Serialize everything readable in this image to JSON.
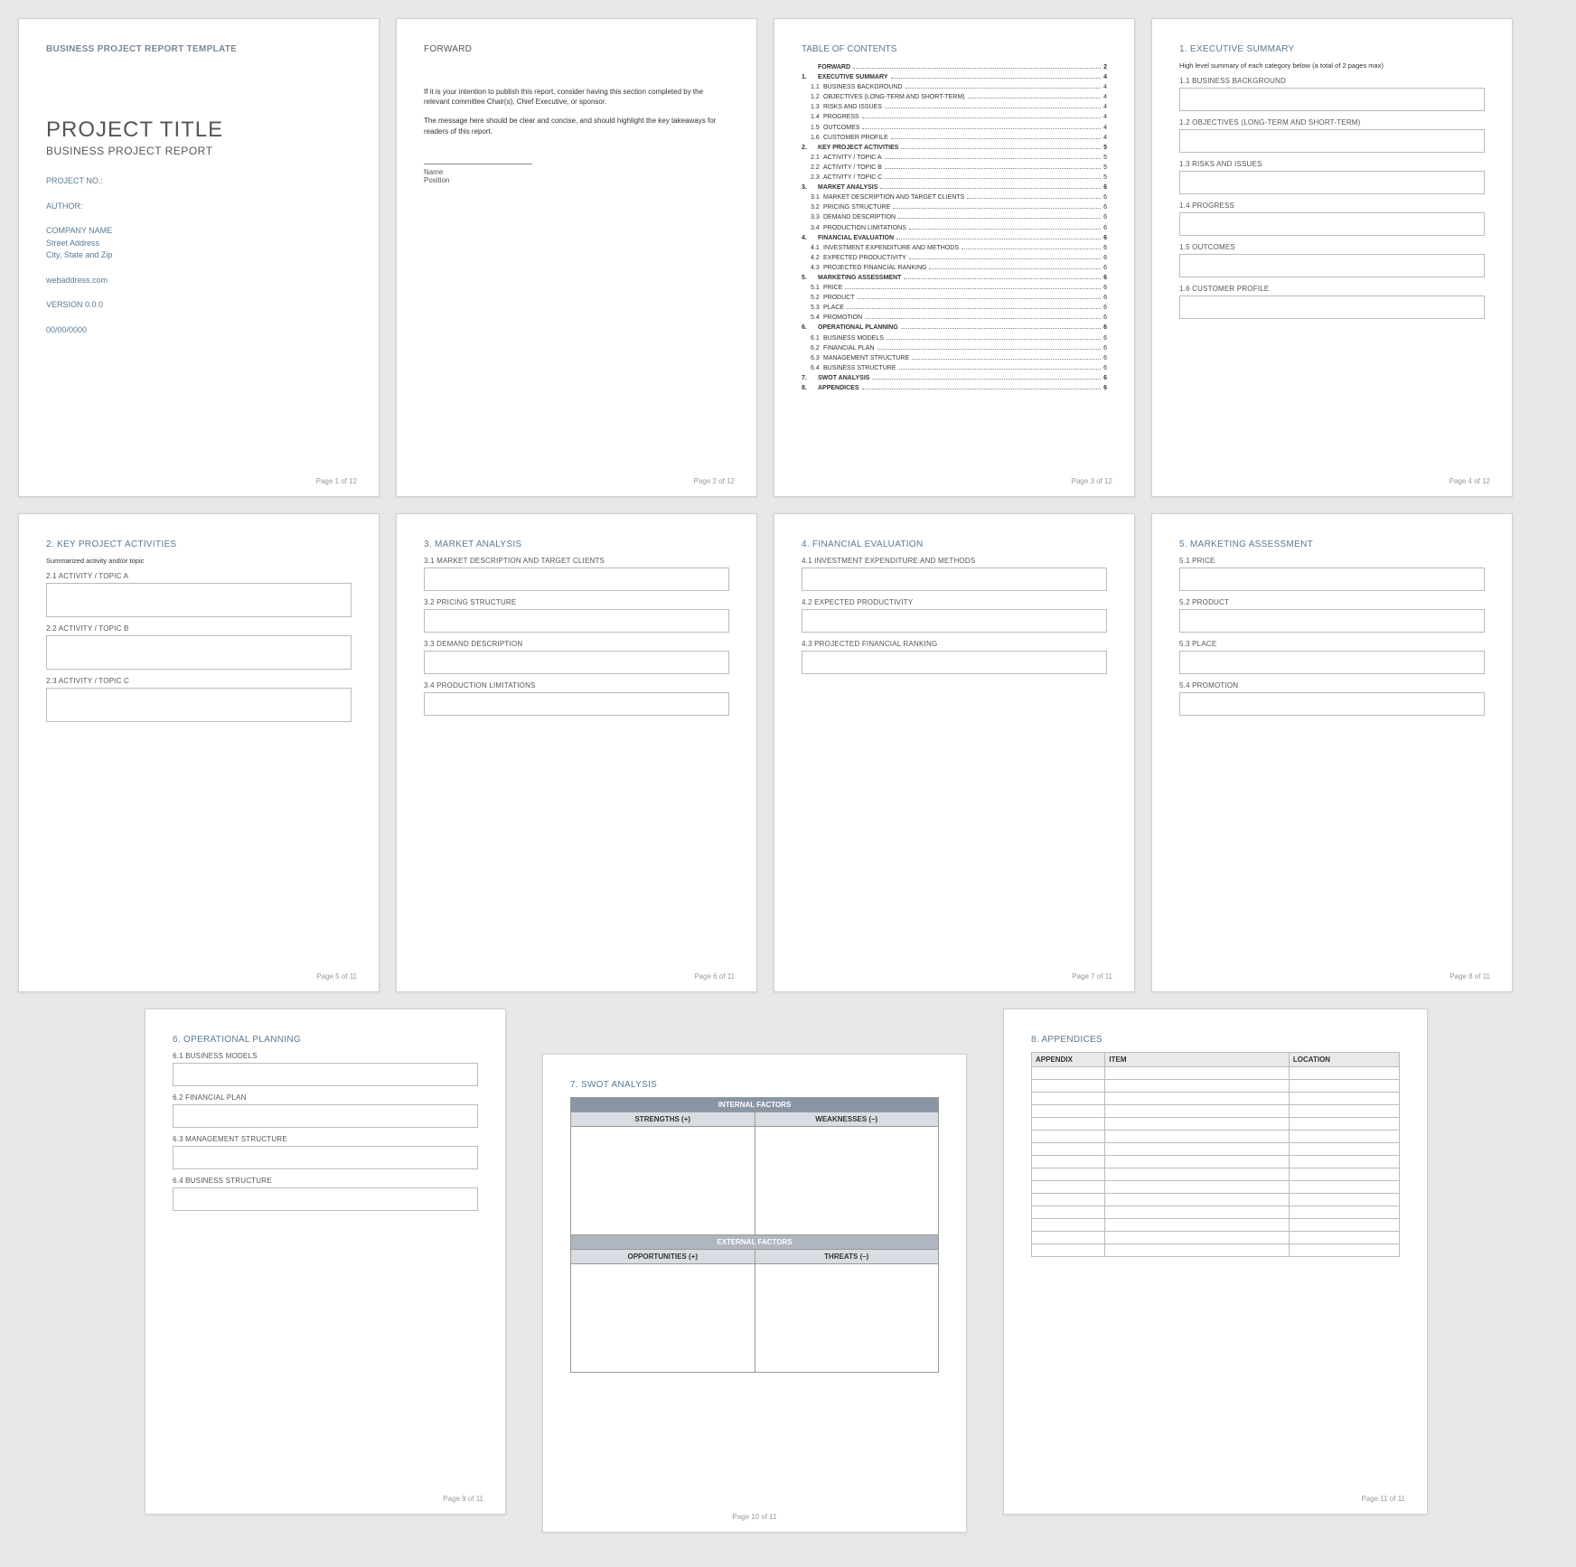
{
  "template_header": "BUSINESS PROJECT REPORT TEMPLATE",
  "cover": {
    "title": "PROJECT TITLE",
    "subtitle": "BUSINESS PROJECT REPORT",
    "project_no_label": "PROJECT NO.:",
    "author_label": "AUTHOR:",
    "company": "COMPANY NAME",
    "street": "Street Address",
    "citystate": "City, State and Zip",
    "web": "webaddress.com",
    "version": "VERSION 0.0.0",
    "date": "00/00/0000",
    "foot": "Page 1 of 12"
  },
  "forward": {
    "heading": "FORWARD",
    "p1": "If it is your intention to publish this report, consider having this section completed by the relevant committee Chair(s), Chief Executive, or sponsor.",
    "p2": "The message here should be clear and concise, and should highlight the key takeaways for readers of this report.",
    "name": "Name",
    "position": "Position",
    "foot": "Page 2 of 12"
  },
  "toc": {
    "heading": "TABLE OF CONTENTS",
    "items": [
      {
        "n": "",
        "t": "FORWARD",
        "p": "2",
        "m": true
      },
      {
        "n": "1.",
        "t": "EXECUTIVE SUMMARY",
        "p": "4",
        "m": true
      },
      {
        "n": "1.1",
        "t": "BUSINESS BACKGROUND",
        "p": "4"
      },
      {
        "n": "1.2",
        "t": "OBJECTIVES (LONG-TERM AND SHORT-TERM)",
        "p": "4"
      },
      {
        "n": "1.3",
        "t": "RISKS AND ISSUES",
        "p": "4"
      },
      {
        "n": "1.4",
        "t": "PROGRESS",
        "p": "4"
      },
      {
        "n": "1.5",
        "t": "OUTCOMES",
        "p": "4"
      },
      {
        "n": "1.6",
        "t": "CUSTOMER PROFILE",
        "p": "4"
      },
      {
        "n": "2.",
        "t": "KEY PROJECT ACTIVITIES",
        "p": "5",
        "m": true
      },
      {
        "n": "2.1",
        "t": "ACTIVITY / TOPIC A",
        "p": "5"
      },
      {
        "n": "2.2",
        "t": "ACTIVITY / TOPIC B",
        "p": "5"
      },
      {
        "n": "2.3",
        "t": "ACTIVITY / TOPIC C",
        "p": "5"
      },
      {
        "n": "3.",
        "t": "MARKET ANALYSIS",
        "p": "6",
        "m": true
      },
      {
        "n": "3.1",
        "t": "MARKET DESCRIPTION AND TARGET CLIENTS",
        "p": "6"
      },
      {
        "n": "3.2",
        "t": "PRICING STRUCTURE",
        "p": "6"
      },
      {
        "n": "3.3",
        "t": "DEMAND DESCRIPTION",
        "p": "6"
      },
      {
        "n": "3.4",
        "t": "PRODUCTION LIMITATIONS",
        "p": "6"
      },
      {
        "n": "4.",
        "t": "FINANCIAL EVALUATION",
        "p": "6",
        "m": true
      },
      {
        "n": "4.1",
        "t": "INVESTMENT EXPENDITURE AND METHODS",
        "p": "6"
      },
      {
        "n": "4.2",
        "t": "EXPECTED PRODUCTIVITY",
        "p": "6"
      },
      {
        "n": "4.3",
        "t": "PROJECTED FINANCIAL RANKING",
        "p": "6"
      },
      {
        "n": "5.",
        "t": "MARKETING ASSESSMENT",
        "p": "6",
        "m": true
      },
      {
        "n": "5.1",
        "t": "PRICE",
        "p": "6"
      },
      {
        "n": "5.2",
        "t": "PRODUCT",
        "p": "6"
      },
      {
        "n": "5.3",
        "t": "PLACE",
        "p": "6"
      },
      {
        "n": "5.4",
        "t": "PROMOTION",
        "p": "6"
      },
      {
        "n": "6.",
        "t": "OPERATIONAL PLANNING",
        "p": "6",
        "m": true
      },
      {
        "n": "6.1",
        "t": "BUSINESS MODELS",
        "p": "6"
      },
      {
        "n": "6.2",
        "t": "FINANCIAL PLAN",
        "p": "6"
      },
      {
        "n": "6.3",
        "t": "MANAGEMENT STRUCTURE",
        "p": "6"
      },
      {
        "n": "6.4",
        "t": "BUSINESS STRUCTURE",
        "p": "6"
      },
      {
        "n": "7.",
        "t": "SWOT ANALYSIS",
        "p": "6",
        "m": true
      },
      {
        "n": "8.",
        "t": "APPENDICES",
        "p": "6",
        "m": true
      }
    ],
    "foot": "Page 3 of 12"
  },
  "exec": {
    "heading": "1. EXECUTIVE SUMMARY",
    "note": "High level summary of each category below (a total of 2 pages max)",
    "s1": "1.1  BUSINESS BACKGROUND",
    "s2": "1.2  OBJECTIVES (LONG-TERM AND SHORT-TERM)",
    "s3": "1.3  RISKS AND ISSUES",
    "s4": "1.4  PROGRESS",
    "s5": "1.5  OUTCOMES",
    "s6": "1.6  CUSTOMER PROFILE",
    "foot": "Page 4 of 12"
  },
  "activities": {
    "heading": "2. KEY PROJECT ACTIVITIES",
    "note": "Summarized activity and/or topic",
    "s1": "2.1  ACTIVITY / TOPIC A",
    "s2": "2.2  ACTIVITY / TOPIC B",
    "s3": "2.3  ACTIVITY / TOPIC C",
    "foot": "Page 5 of 11"
  },
  "market": {
    "heading": "3. MARKET ANALYSIS",
    "s1": "3.1  MARKET DESCRIPTION AND TARGET CLIENTS",
    "s2": "3.2  PRICING STRUCTURE",
    "s3": "3.3  DEMAND DESCRIPTION",
    "s4": "3.4  PRODUCTION LIMITATIONS",
    "foot": "Page 6 of 11"
  },
  "financial": {
    "heading": "4. FINANCIAL EVALUATION",
    "s1": "4.1  INVESTMENT EXPENDITURE AND METHODS",
    "s2": "4.2  EXPECTED PRODUCTIVITY",
    "s3": "4.3  PROJECTED FINANCIAL RANKING",
    "foot": "Page 7 of 11"
  },
  "marketing": {
    "heading": "5. MARKETING ASSESSMENT",
    "s1": "5.1  PRICE",
    "s2": "5.2  PRODUCT",
    "s3": "5.3  PLACE",
    "s4": "5.4  PROMOTION",
    "foot": "Page 8 of 11"
  },
  "opplan": {
    "heading": "6. OPERATIONAL PLANNING",
    "s1": "6.1  BUSINESS MODELS",
    "s2": "6.2  FINANCIAL PLAN",
    "s3": "6.3  MANAGEMENT STRUCTURE",
    "s4": "6.4  BUSINESS STRUCTURE",
    "foot": "Page 9 of 11"
  },
  "swot": {
    "heading": "7. SWOT ANALYSIS",
    "internal": "INTERNAL FACTORS",
    "strengths": "STRENGTHS (+)",
    "weaknesses": "WEAKNESSES (–)",
    "external": "EXTERNAL FACTORS",
    "opportunities": "OPPORTUNITIES (+)",
    "threats": "THREATS (–)",
    "foot": "Page 10 of 11"
  },
  "appendices": {
    "heading": "8. APPENDICES",
    "col1": "APPENDIX",
    "col2": "ITEM",
    "col3": "LOCATION",
    "foot": "Page 11 of 11"
  }
}
